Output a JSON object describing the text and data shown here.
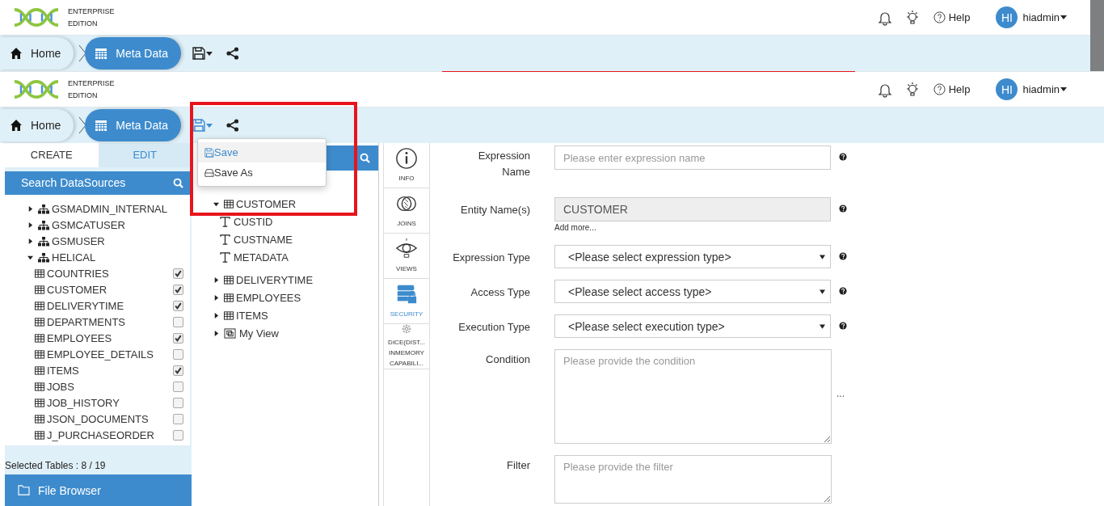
{
  "headers": [
    {
      "edition": [
        "ENTERPRISE",
        "EDITION"
      ],
      "help": "Help",
      "avatar": "HI",
      "user": "hiadmin",
      "breadcrumbs": [
        {
          "label": "Home",
          "selected": false
        },
        {
          "label": "Meta Data",
          "selected": true
        }
      ],
      "save_menu_open": false
    },
    {
      "edition": [
        "ENTERPRISE",
        "EDITION"
      ],
      "help": "Help",
      "avatar": "HI",
      "user": "hiadmin",
      "breadcrumbs": [
        {
          "label": "Home",
          "selected": false
        },
        {
          "label": "Meta Data",
          "selected": true
        }
      ],
      "save_menu_open": true
    }
  ],
  "save_menu": [
    {
      "label": "Save",
      "selected": true
    },
    {
      "label": "Save As",
      "selected": false
    }
  ],
  "left_panel": {
    "tabs": [
      {
        "label": "CREATE",
        "selected": true
      },
      {
        "label": "EDIT",
        "selected": false
      }
    ],
    "search": "Search DataSources",
    "tree": [
      {
        "label": "GSMADMIN_INTERNAL",
        "expanded": false
      },
      {
        "label": "GSMCATUSER",
        "expanded": false
      },
      {
        "label": "GSMUSER",
        "expanded": false
      },
      {
        "label": "HELICAL",
        "expanded": true,
        "children": [
          {
            "label": "COUNTRIES",
            "checked": true
          },
          {
            "label": "CUSTOMER",
            "checked": true
          },
          {
            "label": "DELIVERYTIME",
            "checked": true
          },
          {
            "label": "DEPARTMENTS",
            "checked": false
          },
          {
            "label": "EMPLOYEES",
            "checked": true
          },
          {
            "label": "EMPLOYEE_DETAILS",
            "checked": false
          },
          {
            "label": "ITEMS",
            "checked": true
          },
          {
            "label": "JOBS",
            "checked": false
          },
          {
            "label": "JOB_HISTORY",
            "checked": false
          },
          {
            "label": "JSON_DOCUMENTS",
            "checked": false
          },
          {
            "label": "J_PURCHASEORDER",
            "checked": false
          }
        ]
      }
    ],
    "selected_count": "Selected Tables : 8 / 19",
    "file_browser": "File Browser"
  },
  "entity_tree": [
    {
      "label": "CUSTOMER",
      "kind": "table",
      "expanded": true,
      "children": [
        {
          "label": "CUSTID",
          "kind": "column"
        },
        {
          "label": "CUSTNAME",
          "kind": "column"
        },
        {
          "label": "METADATA",
          "kind": "column"
        }
      ]
    },
    {
      "label": "DELIVERYTIME",
      "kind": "table",
      "expanded": false
    },
    {
      "label": "EMPLOYEES",
      "kind": "table",
      "expanded": false
    },
    {
      "label": "ITEMS",
      "kind": "table",
      "expanded": false
    },
    {
      "label": "My View",
      "kind": "view",
      "expanded": false
    }
  ],
  "side_tabs": [
    {
      "lines": [
        "INFO"
      ],
      "kind": "info",
      "selected": false
    },
    {
      "lines": [
        "JOINS"
      ],
      "kind": "joins",
      "selected": false
    },
    {
      "lines": [
        "VIEWS"
      ],
      "kind": "views",
      "selected": false
    },
    {
      "lines": [
        "SECURITY"
      ],
      "kind": "security",
      "selected": true
    },
    {
      "lines": [
        "DICE(DIST...",
        "INMEMORY",
        "CAPABILI..."
      ],
      "kind": "dice",
      "selected": false
    }
  ],
  "form": [
    {
      "label": "Expression Name",
      "kind": "input",
      "placeholder": "Please enter expression name",
      "help": true
    },
    {
      "label": "Entity Name(s)",
      "kind": "readonly",
      "value": "CUSTOMER",
      "link": "Add more...",
      "help": true
    },
    {
      "label": "Expression Type",
      "kind": "select",
      "value": "<Please select expression type>",
      "help": true
    },
    {
      "label": "Access Type",
      "kind": "select",
      "value": "<Please select access type>",
      "help": true
    },
    {
      "label": "Execution Type",
      "kind": "select",
      "value": "<Please select execution type>",
      "help": true
    },
    {
      "label": "Condition",
      "kind": "textarea",
      "placeholder": "Please provide the condition",
      "side": "...",
      "help": false
    },
    {
      "label": "Filter",
      "kind": "textarea",
      "placeholder": "Please provide the filter",
      "help": false
    }
  ]
}
